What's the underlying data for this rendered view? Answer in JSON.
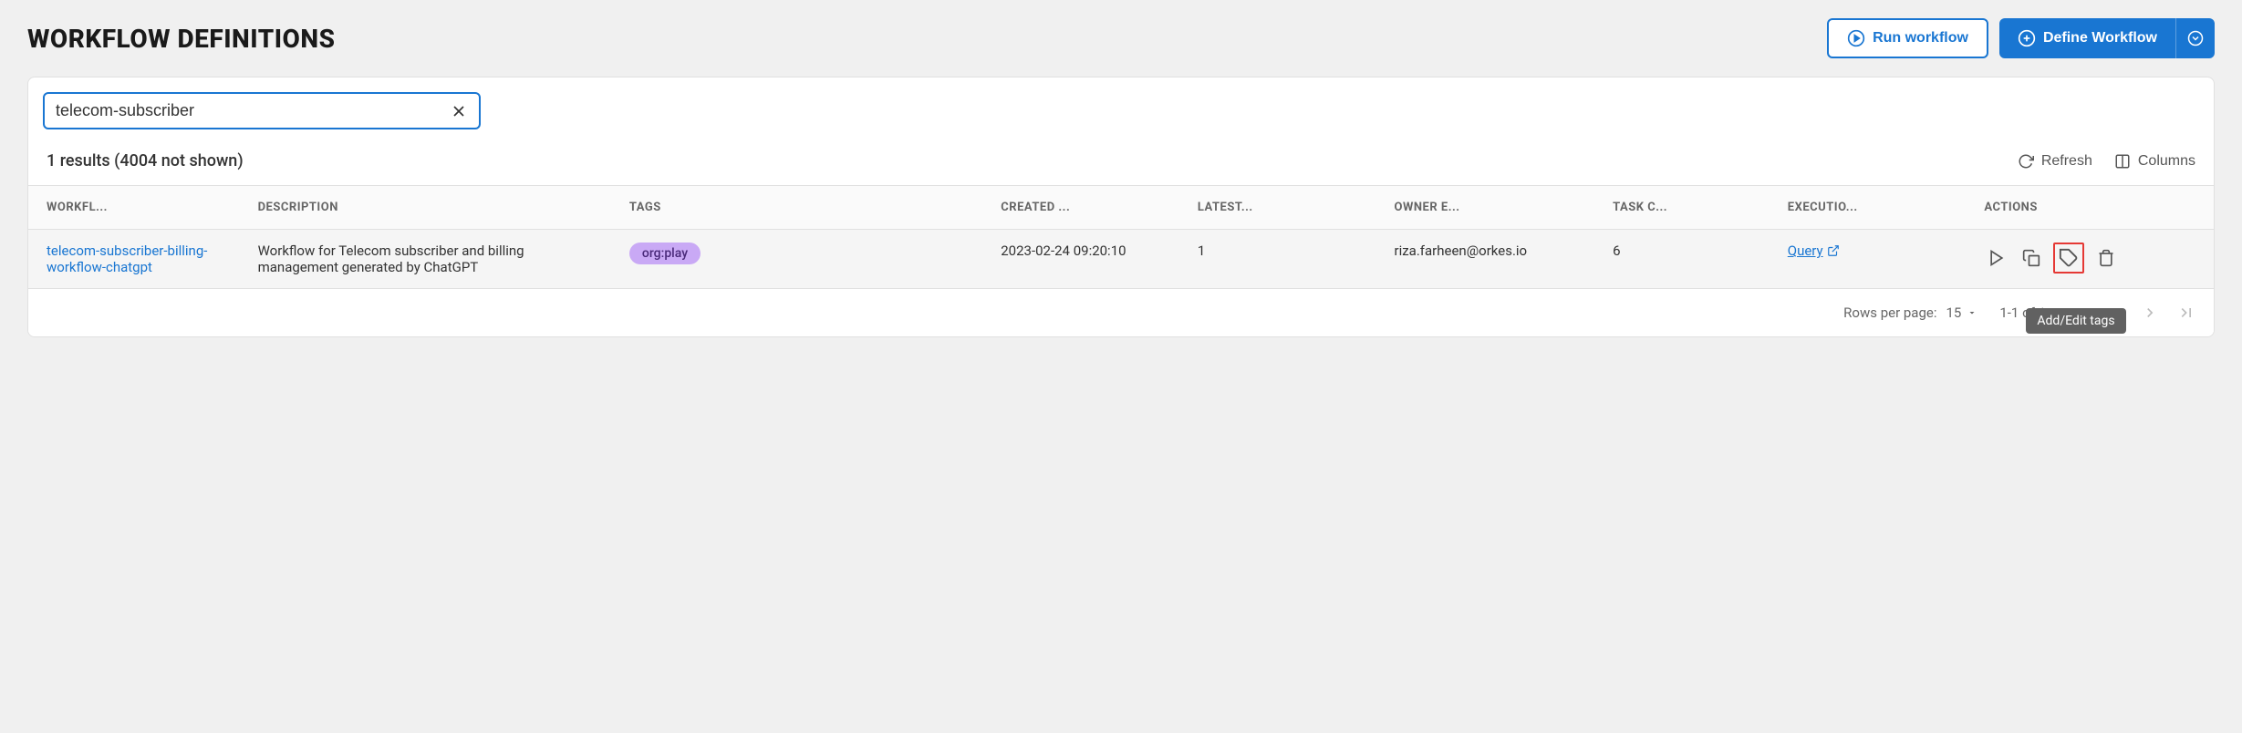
{
  "header": {
    "title": "WORKFLOW DEFINITIONS",
    "runWorkflowLabel": "Run workflow",
    "defineWorkflowLabel": "Define Workflow"
  },
  "search": {
    "value": "telecom-subscriber"
  },
  "toolbar": {
    "resultsText": "1 results (4004 not shown)",
    "refreshLabel": "Refresh",
    "columnsLabel": "Columns"
  },
  "table": {
    "headers": {
      "workflow": "WORKFL...",
      "description": "DESCRIPTION",
      "tags": "TAGS",
      "created": "CREATED ...",
      "latest": "LATEST...",
      "owner": "OWNER E...",
      "taskCount": "TASK C...",
      "executions": "EXECUTIO...",
      "actions": "ACTIONS"
    },
    "rows": [
      {
        "name": "telecom-subscriber-billing-workflow-chatgpt",
        "description": "Workflow for Telecom subscriber and billing management generated by ChatGPT",
        "tag": "org:play",
        "created": "2023-02-24 09:20:10",
        "latest": "1",
        "owner": "riza.farheen@orkes.io",
        "taskCount": "6",
        "executionsLabel": "Query"
      }
    ]
  },
  "tooltip": {
    "addEditTags": "Add/Edit tags"
  },
  "pagination": {
    "rowsPerPageLabel": "Rows per page:",
    "rowsPerPageValue": "15",
    "rangeText": "1-1 of 1"
  }
}
